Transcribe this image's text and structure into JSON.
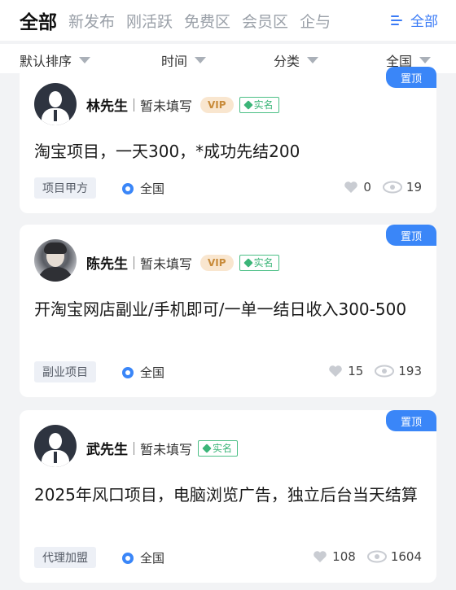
{
  "tabs": [
    "全部",
    "新发布",
    "刚活跃",
    "免费区",
    "会员区",
    "企与"
  ],
  "all_button": "全部",
  "filters": [
    "默认排序",
    "时间",
    "分类",
    "全国"
  ],
  "pin_label": "置顶",
  "vip_label": "VIP",
  "verified_label": "实名",
  "posts": [
    {
      "user": "林先生",
      "status": "暂未填写",
      "vip": true,
      "title": "淘宝项目，一天300，*成功先结200",
      "tag": "项目甲方",
      "location": "全国",
      "likes": "0",
      "views": "19"
    },
    {
      "user": "陈先生",
      "status": "暂未填写",
      "vip": true,
      "title": "开淘宝网店副业/手机即可/一单一结日收入300-500",
      "tag": "副业项目",
      "location": "全国",
      "likes": "15",
      "views": "193"
    },
    {
      "user": "武先生",
      "status": "暂未填写",
      "vip": false,
      "title": "2025年风口项目，电脑浏览广告，独立后台当天结算",
      "tag": "代理加盟",
      "location": "全国",
      "likes": "108",
      "views": "1604"
    }
  ],
  "colors": {
    "accent": "#3a7bf6",
    "pin": "#3a86f8",
    "verified": "#3bb578",
    "vip": "#c88b3a"
  }
}
